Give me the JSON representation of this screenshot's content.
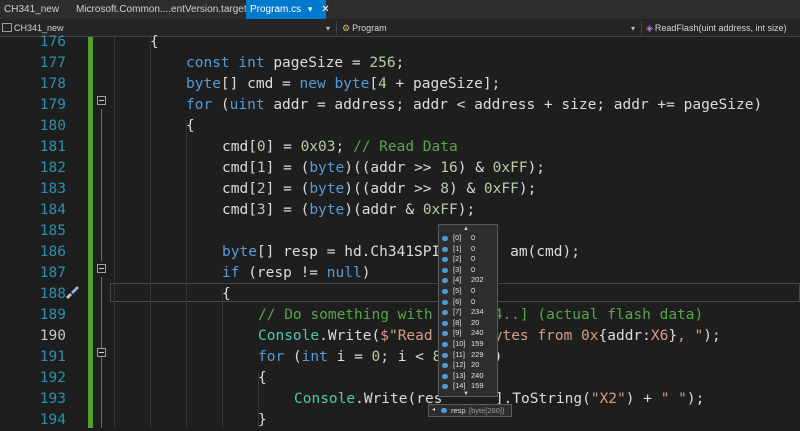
{
  "tabs": [
    {
      "label": "CH341_new"
    },
    {
      "label": "Microsoft.Common....entVersion.targets"
    },
    {
      "label": "Program.cs",
      "active": true
    }
  ],
  "navbar": {
    "project": "CH341_new",
    "class": "Program",
    "member": "ReadFlash(uint address, int size)"
  },
  "editor": {
    "line_numbers": [
      "176",
      "177",
      "178",
      "179",
      "180",
      "181",
      "182",
      "183",
      "184",
      "185",
      "186",
      "187",
      "188",
      "189",
      "190",
      "191",
      "192",
      "193",
      "194"
    ],
    "lines": [
      [
        [
          "p",
          "{"
        ]
      ],
      [
        [
          "kw",
          "const"
        ],
        [
          "p",
          " "
        ],
        [
          "kw",
          "int"
        ],
        [
          "p",
          " pageSize = "
        ],
        [
          "num",
          "256"
        ],
        [
          "p",
          ";"
        ]
      ],
      [
        [
          "kw",
          "byte"
        ],
        [
          "p",
          "[] cmd = "
        ],
        [
          "kw",
          "new"
        ],
        [
          "p",
          " "
        ],
        [
          "kw",
          "byte"
        ],
        [
          "p",
          "["
        ],
        [
          "num",
          "4"
        ],
        [
          "p",
          " + pageSize];"
        ]
      ],
      [
        [
          "kw",
          "for"
        ],
        [
          "p",
          " ("
        ],
        [
          "kw",
          "uint"
        ],
        [
          "p",
          " addr = address; addr < address + size; addr += pageSize)"
        ]
      ],
      [
        [
          "p",
          "{"
        ]
      ],
      [
        [
          "p",
          "cmd["
        ],
        [
          "num",
          "0"
        ],
        [
          "p",
          "] = "
        ],
        [
          "num",
          "0x03"
        ],
        [
          "p",
          "; "
        ],
        [
          "cmt",
          "// Read Data"
        ]
      ],
      [
        [
          "p",
          "cmd["
        ],
        [
          "num",
          "1"
        ],
        [
          "p",
          "] = ("
        ],
        [
          "kw",
          "byte"
        ],
        [
          "p",
          ")((addr >> "
        ],
        [
          "num",
          "16"
        ],
        [
          "p",
          ") & "
        ],
        [
          "num",
          "0xFF"
        ],
        [
          "p",
          ");"
        ]
      ],
      [
        [
          "p",
          "cmd["
        ],
        [
          "num",
          "2"
        ],
        [
          "p",
          "] = ("
        ],
        [
          "kw",
          "byte"
        ],
        [
          "p",
          ")((addr >> "
        ],
        [
          "num",
          "8"
        ],
        [
          "p",
          ") & "
        ],
        [
          "num",
          "0xFF"
        ],
        [
          "p",
          ");"
        ]
      ],
      [
        [
          "p",
          "cmd["
        ],
        [
          "num",
          "3"
        ],
        [
          "p",
          "] = ("
        ],
        [
          "kw",
          "byte"
        ],
        [
          "p",
          ")(addr & "
        ],
        [
          "num",
          "0xFF"
        ],
        [
          "p",
          ");"
        ]
      ],
      [],
      [
        [
          "kw",
          "byte"
        ],
        [
          "p",
          "[] resp = hd.Ch341SPI"
        ],
        [
          "p",
          "        am(cmd);"
        ]
      ],
      [
        [
          "kw",
          "if"
        ],
        [
          "p",
          " (resp != "
        ],
        [
          "kw",
          "null"
        ],
        [
          "p",
          ")"
        ]
      ],
      [
        [
          "p",
          "{"
        ]
      ],
      [
        [
          "cmt",
          "// Do something with"
        ],
        [
          "p",
          "       "
        ],
        [
          "cmt",
          "4..] (actual flash data)"
        ]
      ],
      [
        [
          "type",
          "Console"
        ],
        [
          "p",
          "."
        ],
        [
          "p",
          "Write("
        ],
        [
          "str",
          "$\"Read"
        ],
        [
          "p",
          "       "
        ],
        [
          "str",
          "ytes from 0x"
        ],
        [
          "p",
          "{addr:"
        ],
        [
          "str",
          "X6"
        ],
        [
          "p",
          "}"
        ],
        [
          "str",
          ", \""
        ],
        [
          "p",
          ");"
        ]
      ],
      [
        [
          "kw",
          "for"
        ],
        [
          "p",
          " ("
        ],
        [
          "kw",
          "int"
        ],
        [
          "p",
          " i = "
        ],
        [
          "num",
          "0"
        ],
        [
          "p",
          "; i < "
        ],
        [
          "num",
          "8"
        ],
        [
          "p",
          "      )"
        ]
      ],
      [
        [
          "p",
          "{"
        ]
      ],
      [
        [
          "type",
          "Console"
        ],
        [
          "p",
          ".Write(res"
        ],
        [
          "p",
          "      "
        ],
        [
          "p",
          "].ToString("
        ],
        [
          "str",
          "\"X2\""
        ],
        [
          "p",
          ") + "
        ],
        [
          "str",
          "\" \""
        ],
        [
          "p",
          ");"
        ]
      ],
      [
        [
          "p",
          "}"
        ]
      ]
    ]
  },
  "tooltip": {
    "items": [
      {
        "index": "[0]",
        "value": "0"
      },
      {
        "index": "[1]",
        "value": "0"
      },
      {
        "index": "[2]",
        "value": "0"
      },
      {
        "index": "[3]",
        "value": "0"
      },
      {
        "index": "[4]",
        "value": "202"
      },
      {
        "index": "[5]",
        "value": "0"
      },
      {
        "index": "[6]",
        "value": "0"
      },
      {
        "index": "[7]",
        "value": "234"
      },
      {
        "index": "[8]",
        "value": "20"
      },
      {
        "index": "[9]",
        "value": "240"
      },
      {
        "index": "[10]",
        "value": "159"
      },
      {
        "index": "[11]",
        "value": "229"
      },
      {
        "index": "[12]",
        "value": "20"
      },
      {
        "index": "[13]",
        "value": "240"
      },
      {
        "index": "[14]",
        "value": "159"
      }
    ],
    "variable_name": "resp",
    "variable_type": "{byte[260]}"
  },
  "colors": {
    "background": "#1e1e1e",
    "keyword": "#569cd6",
    "number": "#b5cea8",
    "string": "#d69d85",
    "type": "#4ec9b0",
    "comment": "#57a64a",
    "line_number": "#2b91af",
    "active_tab": "#007acc"
  }
}
